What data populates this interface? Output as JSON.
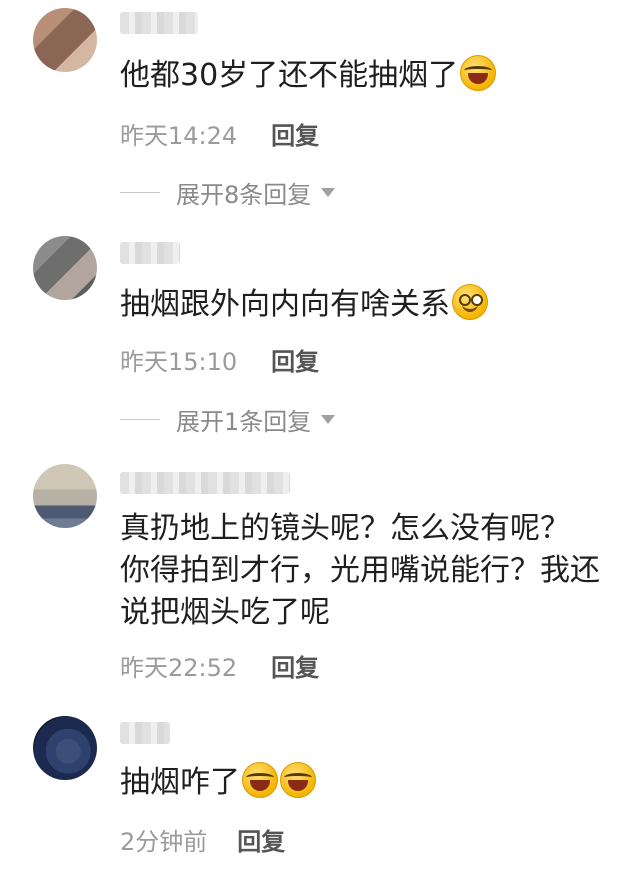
{
  "comments": [
    {
      "text": "他都30岁了还不能抽烟了",
      "emoji": [
        "laugh-cry-emoji"
      ],
      "time": "昨天14:24",
      "reply_label": "回复",
      "expand_label": "展开8条回复",
      "avatar_colors": [
        "#b98f78",
        "#8c6654",
        "#d3b7a3",
        "#a77c68"
      ]
    },
    {
      "text": "抽烟跟外向内向有啥关系",
      "emoji": [
        "smile-emoji"
      ],
      "time": "昨天15:10",
      "reply_label": "回复",
      "expand_label": "展开1条回复",
      "avatar_colors": [
        "#8c8c8c",
        "#6e6e6e",
        "#b1a59d",
        "#5e5e5e"
      ]
    },
    {
      "text_line1": "真扔地上的镜头呢？怎么没有呢？",
      "text_line2": "你得拍到才行，光用嘴说能行？我还",
      "text_line3": "说把烟头吃了呢",
      "time": "昨天22:52",
      "reply_label": "回复",
      "avatar_colors": [
        "#b7b0a4",
        "#4e5a74",
        "#cfc6b6",
        "#6f7d94"
      ]
    },
    {
      "text": "抽烟咋了",
      "emoji": [
        "laugh-cry-emoji",
        "laugh-cry-emoji"
      ],
      "time": "2分钟前",
      "reply_label": "回复",
      "avatar_colors": [
        "#1c2a4f",
        "#2f416e",
        "#0e1630",
        "#3c4e7a"
      ]
    }
  ]
}
